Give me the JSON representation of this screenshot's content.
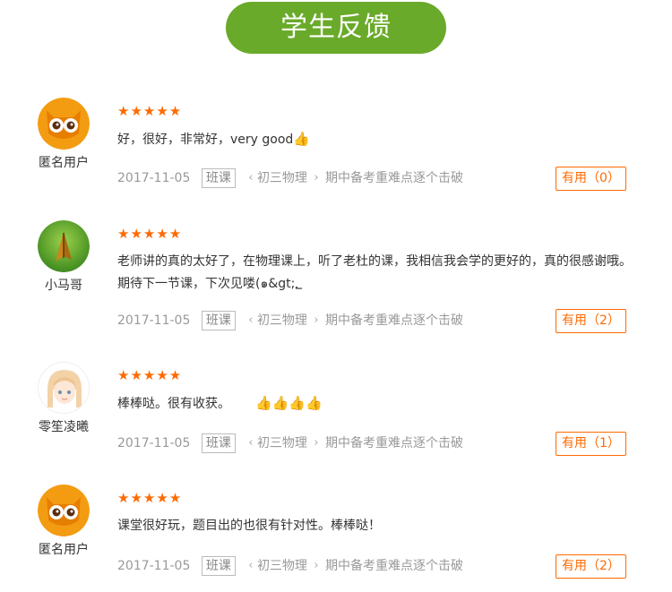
{
  "header": {
    "title": "学生反馈"
  },
  "reviews": [
    {
      "username": "匿名用户",
      "avatar_icon": "owl-avatar-icon",
      "stars": "★★★★★",
      "comment": "好，很好，非常好，very good",
      "thumbs": "👍",
      "date": "2017-11-05",
      "tag": "班课",
      "course": "初三物理",
      "lesson": "期中备考重难点逐个击破",
      "useful_label": "有用（0）"
    },
    {
      "username": "小马哥",
      "avatar_icon": "butterfly-avatar-icon",
      "stars": "★★★★★",
      "comment": "老师讲的真的太好了，在物理课上，听了老杜的课，我相信我会学的更好的，真的很感谢哦。期待下一节课，下次见喽(๑&gt;؂",
      "thumbs": "",
      "date": "2017-11-05",
      "tag": "班课",
      "course": "初三物理",
      "lesson": "期中备考重难点逐个击破",
      "useful_label": "有用（2）"
    },
    {
      "username": "零笙凌曦",
      "avatar_icon": "anime-girl-avatar-icon",
      "stars": "★★★★★",
      "comment": "棒棒哒。很有收获。",
      "thumbs": "👍👍👍👍",
      "date": "2017-11-05",
      "tag": "班课",
      "course": "初三物理",
      "lesson": "期中备考重难点逐个击破",
      "useful_label": "有用（1）"
    },
    {
      "username": "匿名用户",
      "avatar_icon": "owl-avatar-icon",
      "stars": "★★★★★",
      "comment": "课堂很好玩，题目出的也很有针对性。棒棒哒！",
      "thumbs": "",
      "date": "2017-11-05",
      "tag": "班课",
      "course": "初三物理",
      "lesson": "期中备考重难点逐个击破",
      "useful_label": "有用（2）"
    }
  ],
  "colors": {
    "accent_green": "#6aaa2a",
    "accent_orange": "#ff6a00",
    "muted": "#999999"
  }
}
